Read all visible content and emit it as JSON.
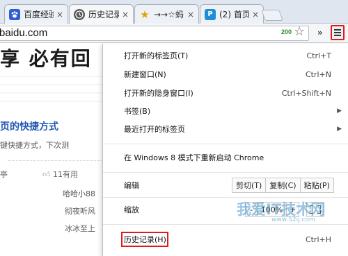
{
  "tabs": [
    {
      "title": "百度经验",
      "icon": "baidu-paw-icon"
    },
    {
      "title": "历史记录",
      "icon": "history-clock-icon"
    },
    {
      "title": "→→☆蚂",
      "icon": "star-favicon"
    },
    {
      "title": "(2) 首页",
      "icon": "p-favicon"
    }
  ],
  "close_glyph": "×",
  "toolbar": {
    "url": "baidu.com",
    "badge": "200",
    "bookmark_star": "☆",
    "overflow": "»"
  },
  "page": {
    "banner_text": "享 必有回",
    "heading": "页的快捷方式",
    "subtext": "键快捷方式，下次测",
    "meta_left": "亭",
    "meta_right": "11有用",
    "names": [
      "哈哈小88",
      "彻夜听风",
      "冰冰至上"
    ]
  },
  "menu": {
    "new_tab": {
      "label": "打开新的标签页(T)",
      "shortcut": "Ctrl+T"
    },
    "new_window": {
      "label": "新建窗口(N)",
      "shortcut": "Ctrl+N"
    },
    "incognito": {
      "label": "打开新的隐身窗口(I)",
      "shortcut": "Ctrl+Shift+N"
    },
    "bookmarks": {
      "label": "书签(B)"
    },
    "recent_tabs": {
      "label": "最近打开的标签页"
    },
    "relaunch": {
      "label": "在 Windows 8 模式下重新启动 Chrome"
    },
    "edit": {
      "label": "编辑",
      "cut": "剪切(T)",
      "copy": "复制(C)",
      "paste": "粘贴(P)"
    },
    "zoom": {
      "label": "缩放",
      "minus": "-",
      "level": "100%",
      "plus": "+"
    },
    "history": {
      "label": "历史记录(H)",
      "shortcut": "Ctrl+H"
    }
  },
  "watermark": {
    "text": "我爱IT技术网",
    "sub": "www.52ij.com"
  },
  "colors": {
    "highlight_box": "#e01b1b",
    "link": "#1f56b3"
  }
}
